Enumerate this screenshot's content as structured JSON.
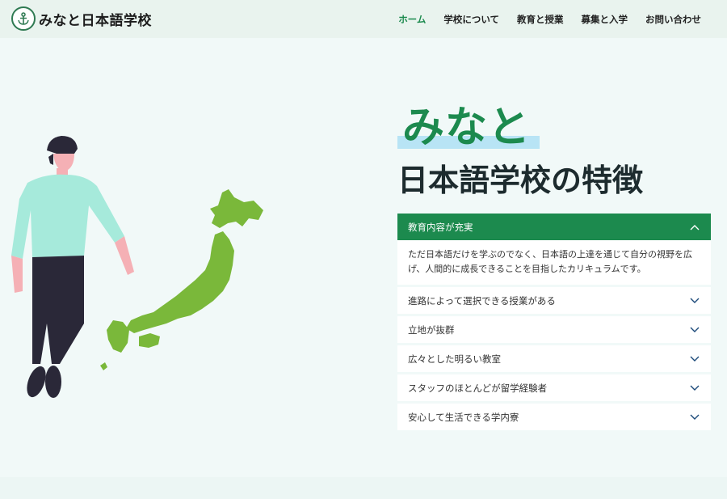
{
  "header": {
    "logo_text": "みなと日本語学校",
    "nav": [
      {
        "label": "ホーム",
        "active": true
      },
      {
        "label": "学校について",
        "active": false
      },
      {
        "label": "教育と授業",
        "active": false
      },
      {
        "label": "募集と入学",
        "active": false
      },
      {
        "label": "お問い合わせ",
        "active": false
      }
    ]
  },
  "hero": {
    "title_line1": "みなと",
    "title_line2": "日本語学校の特徴"
  },
  "accordion": {
    "open_item": {
      "label": "教育内容が充実",
      "icon": "chevron-up-icon",
      "body": "ただ日本語だけを学ぶのでなく、日本語の上達を通じて自分の視野を広げ、人間的に成長できることを目指したカリキュラムです。"
    },
    "items": [
      {
        "label": "進路によって選択できる授業がある",
        "icon": "chevron-down-icon"
      },
      {
        "label": "立地が抜群",
        "icon": "chevron-down-icon"
      },
      {
        "label": "広々とした明るい教室",
        "icon": "chevron-down-icon"
      },
      {
        "label": "スタッフのほとんどが留学経験者",
        "icon": "chevron-down-icon"
      },
      {
        "label": "安心して生活できる学内寮",
        "icon": "chevron-down-icon"
      }
    ]
  },
  "colors": {
    "brand_green": "#1c8a4e",
    "highlight_blue": "#b8e4f5",
    "map_green": "#7ab83a",
    "shirt": "#a6eadb",
    "pants": "#2a2838"
  }
}
